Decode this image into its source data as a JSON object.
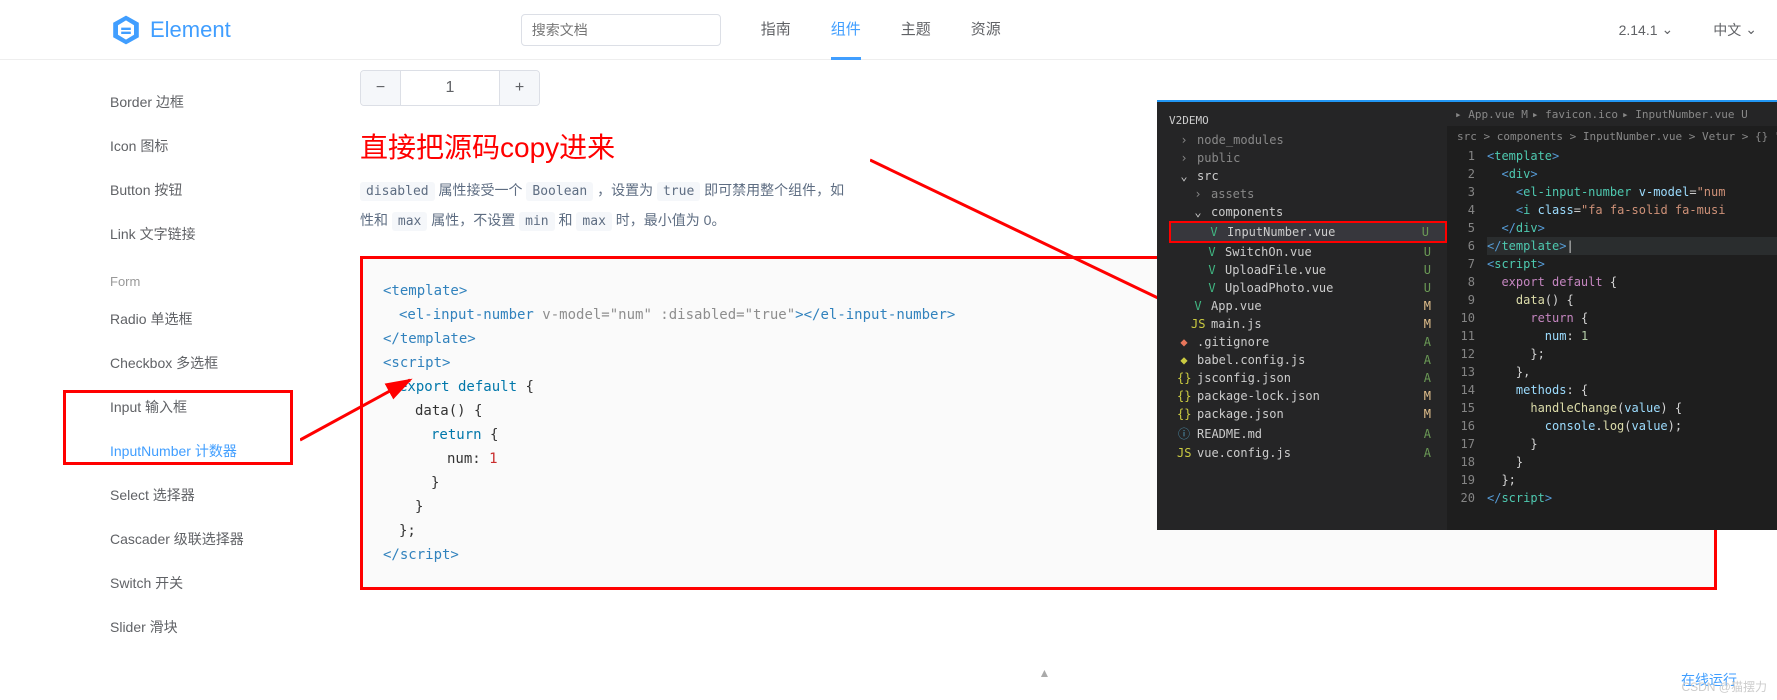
{
  "header": {
    "brand": "Element",
    "search_placeholder": "搜索文档",
    "nav": [
      "指南",
      "组件",
      "主题",
      "资源"
    ],
    "active_nav_index": 1,
    "version": "2.14.1",
    "lang": "中文"
  },
  "sidebar": {
    "items_top": [
      "Border 边框",
      "Icon 图标",
      "Button 按钮",
      "Link 文字链接"
    ],
    "group_label": "Form",
    "items_form": [
      "Radio 单选框",
      "Checkbox 多选框",
      "Input 输入框",
      "InputNumber 计数器",
      "Select 选择器",
      "Cascader 级联选择器",
      "Switch 开关",
      "Slider 滑块"
    ],
    "active_form_index": 3
  },
  "demo": {
    "input_value": "1",
    "minus": "−",
    "plus": "+"
  },
  "annotation": {
    "title": "直接把源码copy进来"
  },
  "description": {
    "tags": {
      "disabled": "disabled",
      "boolean": "Boolean",
      "true": "true",
      "max": "max",
      "min": "min",
      "max2": "max"
    },
    "text1_a": " 属性接受一个 ",
    "text1_b": " ，设置为 ",
    "text1_c": " 即可禁用整个组件，如",
    "text2_a": "性和 ",
    "text2_b": " 属性，不设置 ",
    "text2_c": " 和 ",
    "text2_d": " 时，最小值为 0。"
  },
  "code_block": {
    "lines": [
      {
        "indent": 0,
        "html": "<span class='tag'>&lt;template&gt;</span>"
      },
      {
        "indent": 1,
        "html": "<span class='tag'>&lt;el-input-number</span> <span class='attr'>v-model=\"num\" :disabled=\"true\"</span><span class='tag'>&gt;&lt;/el-input-number&gt;</span>"
      },
      {
        "indent": 0,
        "html": "<span class='tag'>&lt;/template&gt;</span>"
      },
      {
        "indent": 0,
        "html": "<span class='tag'>&lt;script&gt;</span>"
      },
      {
        "indent": 1,
        "html": "<span class='kw'>export default</span> {"
      },
      {
        "indent": 2,
        "html": "data() {"
      },
      {
        "indent": 3,
        "html": "<span class='kw'>return</span> {"
      },
      {
        "indent": 4,
        "html": "num: <span class='num'>1</span>"
      },
      {
        "indent": 3,
        "html": "}"
      },
      {
        "indent": 2,
        "html": "}"
      },
      {
        "indent": 1,
        "html": "};"
      },
      {
        "indent": 0,
        "html": "<span class='tag'>&lt;/script&gt;</span>"
      }
    ]
  },
  "vscode": {
    "tabs": [
      "App.vue M",
      "favicon.ico",
      "InputNumber.vue U"
    ],
    "breadcrumb": "src > components > InputNumber.vue > Vetur > {} \"InputNumb",
    "project": "V2DEMO",
    "tree": [
      {
        "label": "node_modules",
        "icon": "›",
        "dim": true,
        "indent": 0
      },
      {
        "label": "public",
        "icon": "›",
        "dim": true,
        "indent": 0
      },
      {
        "label": "src",
        "icon": "⌄",
        "dim": false,
        "indent": 0
      },
      {
        "label": "assets",
        "icon": "›",
        "dim": true,
        "indent": 1
      },
      {
        "label": "components",
        "icon": "⌄",
        "dim": false,
        "indent": 1
      },
      {
        "label": "InputNumber.vue",
        "icon": "V",
        "iconClass": "icon-vue",
        "status": "U",
        "indent": 2,
        "selected": true,
        "redbox": true
      },
      {
        "label": "SwitchOn.vue",
        "icon": "V",
        "iconClass": "icon-vue",
        "status": "U",
        "indent": 2
      },
      {
        "label": "UploadFile.vue",
        "icon": "V",
        "iconClass": "icon-vue",
        "status": "U",
        "indent": 2
      },
      {
        "label": "UploadPhoto.vue",
        "icon": "V",
        "iconClass": "icon-vue",
        "status": "U",
        "indent": 2
      },
      {
        "label": "App.vue",
        "icon": "V",
        "iconClass": "icon-vue",
        "status": "M",
        "statusClass": "m",
        "indent": 1
      },
      {
        "label": "main.js",
        "icon": "JS",
        "iconClass": "icon-js",
        "status": "M",
        "statusClass": "m",
        "indent": 1
      },
      {
        "label": ".gitignore",
        "icon": "◆",
        "iconClass": "icon-git",
        "status": "A",
        "statusClass": "a",
        "indent": 0
      },
      {
        "label": "babel.config.js",
        "icon": "◆",
        "iconClass": "icon-js",
        "status": "A",
        "statusClass": "a",
        "indent": 0
      },
      {
        "label": "jsconfig.json",
        "icon": "{}",
        "iconClass": "icon-json",
        "status": "A",
        "statusClass": "a",
        "indent": 0
      },
      {
        "label": "package-lock.json",
        "icon": "{}",
        "iconClass": "icon-json",
        "status": "M",
        "statusClass": "m",
        "indent": 0
      },
      {
        "label": "package.json",
        "icon": "{}",
        "iconClass": "icon-json",
        "status": "M",
        "statusClass": "m",
        "indent": 0
      },
      {
        "label": "README.md",
        "icon": "ⓘ",
        "iconClass": "icon-md",
        "status": "A",
        "statusClass": "a",
        "indent": 0
      },
      {
        "label": "vue.config.js",
        "icon": "JS",
        "iconClass": "icon-js",
        "status": "A",
        "statusClass": "a",
        "indent": 0
      }
    ],
    "code_lines": [
      "<span class='tag'>&lt;</span><span class='tagname'>template</span><span class='tag'>&gt;</span>",
      "  <span class='tag'>&lt;</span><span class='tagname'>div</span><span class='tag'>&gt;</span>",
      "    <span class='tag'>&lt;</span><span class='tagname'>el-input-number</span> <span class='attr'>v-model</span>=<span class='str'>\"num</span>",
      "    <span class='tag'>&lt;</span><span class='tagname'>i</span> <span class='attr'>class</span>=<span class='str'>\"fa fa-solid fa-musi</span>",
      "  <span class='tag'>&lt;/</span><span class='tagname'>div</span><span class='tag'>&gt;</span>",
      "<span class='tag'>&lt;/</span><span class='tagname'>template</span><span class='tag'>&gt;</span>|",
      "<span class='tag'>&lt;</span><span class='tagname'>script</span><span class='tag'>&gt;</span>",
      "  <span class='kw'>export default</span> <span class='punct'>{</span>",
      "    <span class='fn'>data</span><span class='punct'>() {</span>",
      "      <span class='kw'>return</span> <span class='punct'>{</span>",
      "        <span class='var'>num</span><span class='punct'>:</span> <span class='num'>1</span>",
      "      <span class='punct'>};</span>",
      "    <span class='punct'>},</span>",
      "    <span class='var'>methods</span><span class='punct'>: {</span>",
      "      <span class='fn'>handleChange</span><span class='punct'>(</span><span class='var'>value</span><span class='punct'>) {</span>",
      "        <span class='var'>console</span><span class='punct'>.</span><span class='fn'>log</span><span class='punct'>(</span><span class='var'>value</span><span class='punct'>);</span>",
      "      <span class='punct'>}</span>",
      "    <span class='punct'>}</span>",
      "  <span class='punct'>};</span>",
      "<span class='tag'>&lt;/</span><span class='tagname'>script</span><span class='tag'>&gt;</span>"
    ]
  },
  "footer": {
    "online_run": "在线运行",
    "watermark": "CSDN @猫摆力"
  }
}
